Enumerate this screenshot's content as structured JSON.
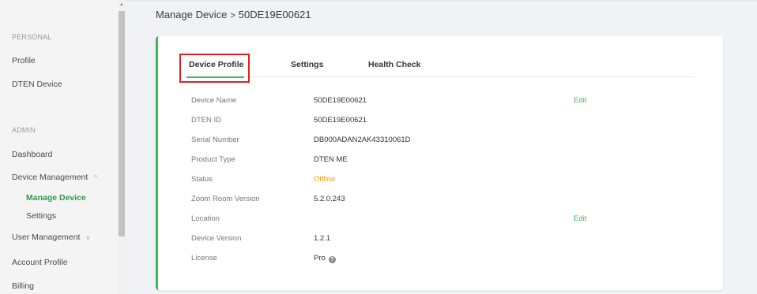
{
  "sidebar": {
    "sections": {
      "personal": "PERSONAL",
      "admin": "ADMIN"
    },
    "items": [
      {
        "label": "Profile"
      },
      {
        "label": "DTEN Device"
      },
      {
        "label": "Dashboard"
      },
      {
        "label": "Device Management",
        "chevron": "^"
      },
      {
        "label": "Manage Device"
      },
      {
        "label": "Settings"
      },
      {
        "label": "User Management",
        "chevron": "v"
      },
      {
        "label": "Account Profile"
      },
      {
        "label": "Billing"
      }
    ]
  },
  "breadcrumb": {
    "parent": "Manage Device",
    "separator": ">",
    "current": "50DE19E00621"
  },
  "tabs": [
    {
      "label": "Device Profile"
    },
    {
      "label": "Settings"
    },
    {
      "label": "Health Check"
    }
  ],
  "details": [
    {
      "label": "Device Name",
      "value": "50DE19E00621",
      "edit": "Edit"
    },
    {
      "label": "DTEN ID",
      "value": "50DE19E00621"
    },
    {
      "label": "Serial Number",
      "value": "DB000ADAN2AK43310061D"
    },
    {
      "label": "Product Type",
      "value": "DTEN ME"
    },
    {
      "label": "Status",
      "value": "Offline"
    },
    {
      "label": "Zoom Room Version",
      "value": "5.2.0.243"
    },
    {
      "label": "Location",
      "value": "",
      "edit": "Edit"
    },
    {
      "label": "Device Version",
      "value": "1.2.1"
    },
    {
      "label": "License",
      "value": "Pro"
    }
  ],
  "colors": {
    "accent": "#3fb859",
    "offline": "#f0a020",
    "highlight": "#e02020"
  },
  "icons": {
    "license_help": "question-circle-icon"
  }
}
